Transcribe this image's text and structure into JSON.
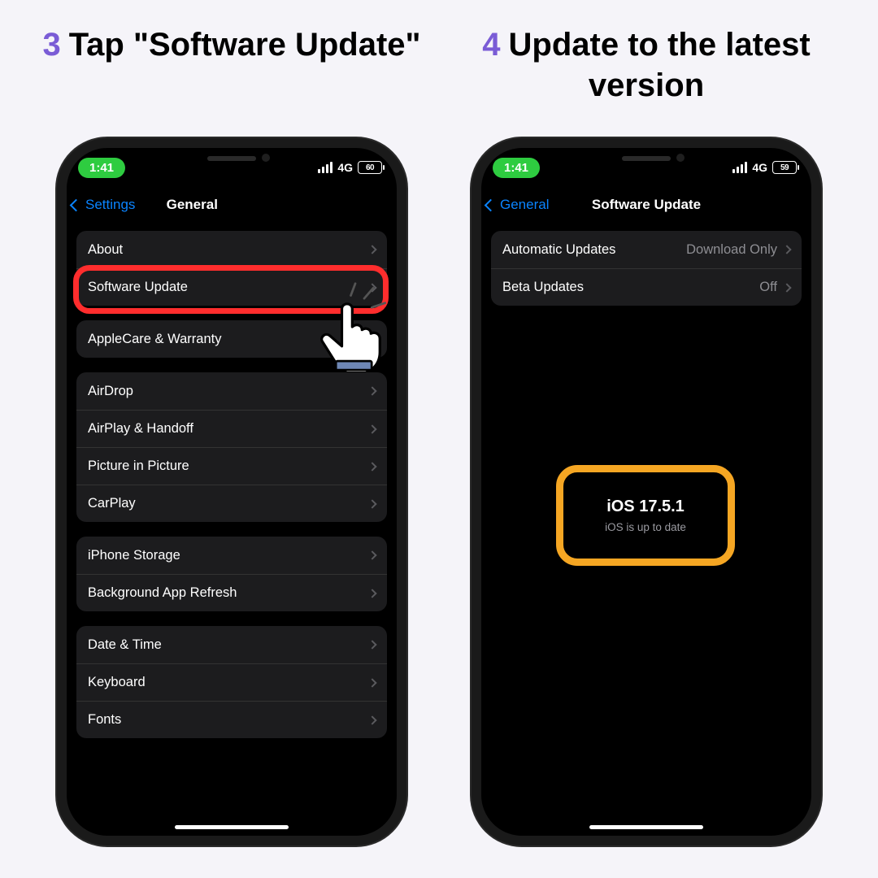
{
  "steps": {
    "left": {
      "num": "3",
      "title": "Tap \"Software Update\""
    },
    "right": {
      "num": "4",
      "title": "Update to the latest version"
    }
  },
  "status": {
    "time": "1:41",
    "network": "4G",
    "battery_left": "60",
    "battery_right": "59"
  },
  "phone_left": {
    "back_label": "Settings",
    "title": "General",
    "groups": [
      {
        "rows": [
          {
            "label": "About"
          },
          {
            "label": "Software Update"
          }
        ]
      },
      {
        "rows": [
          {
            "label": "AppleCare & Warranty"
          }
        ]
      },
      {
        "rows": [
          {
            "label": "AirDrop"
          },
          {
            "label": "AirPlay & Handoff"
          },
          {
            "label": "Picture in Picture"
          },
          {
            "label": "CarPlay"
          }
        ]
      },
      {
        "rows": [
          {
            "label": "iPhone Storage"
          },
          {
            "label": "Background App Refresh"
          }
        ]
      },
      {
        "rows": [
          {
            "label": "Date & Time"
          },
          {
            "label": "Keyboard"
          },
          {
            "label": "Fonts"
          }
        ]
      }
    ]
  },
  "phone_right": {
    "back_label": "General",
    "title": "Software Update",
    "rows": [
      {
        "label": "Automatic Updates",
        "value": "Download Only"
      },
      {
        "label": "Beta Updates",
        "value": "Off"
      }
    ],
    "ios_version": "iOS 17.5.1",
    "ios_status": "iOS is up to date"
  },
  "colors": {
    "accent": "#7a5cd6",
    "link": "#0a84ff",
    "red": "#ff2d2d",
    "orange": "#f5a623"
  }
}
